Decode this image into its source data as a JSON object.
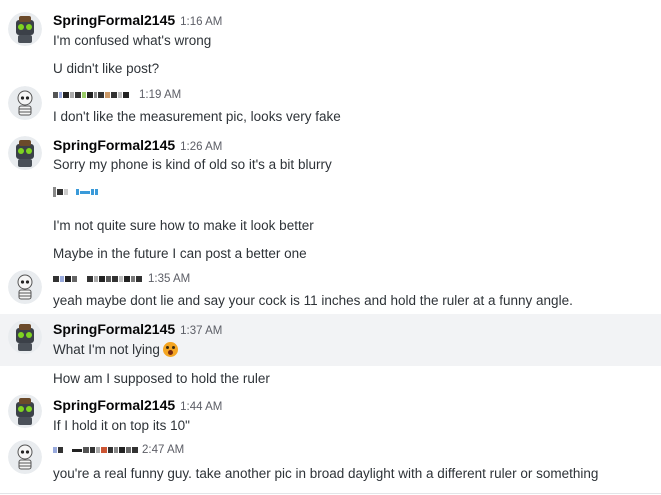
{
  "channel": {
    "messages": [
      {
        "author": "SpringFormal2145",
        "time": "1:16 AM",
        "lines": [
          "I'm confused what's wrong",
          "U didn't like post?"
        ]
      },
      {
        "author": "",
        "time": "1:19 AM",
        "lines": [
          "I don't like the measurement pic, looks very fake"
        ]
      },
      {
        "author": "SpringFormal2145",
        "time": "1:26 AM",
        "lines": [
          "Sorry my phone is kind of old so it's a bit blurry",
          "I'm not quite sure how to make it look better",
          "Maybe in the future I can post a better one"
        ]
      },
      {
        "author": "",
        "time": "1:35 AM",
        "lines": [
          "yeah maybe dont lie and say your cock is 11 inches and hold the ruler at a funny angle."
        ]
      },
      {
        "author": "SpringFormal2145",
        "time": "1:37 AM",
        "lines": [
          "What I'm not lying",
          "How am I supposed to hold the ruler"
        ]
      },
      {
        "author": "SpringFormal2145",
        "time": "1:44 AM",
        "lines": [
          "If I hold it on top its 10\""
        ]
      },
      {
        "author": "",
        "time": "2:47 AM",
        "lines": [
          "you're a real funny guy. take another pic in broad daylight with a different ruler or something"
        ]
      }
    ]
  },
  "emoji": {
    "reaction": "pleading-face"
  },
  "colors": {
    "hover_bg": "#f2f3f5",
    "username": "#060607",
    "text": "#2e3338",
    "timestamp": "#5c5e66"
  }
}
